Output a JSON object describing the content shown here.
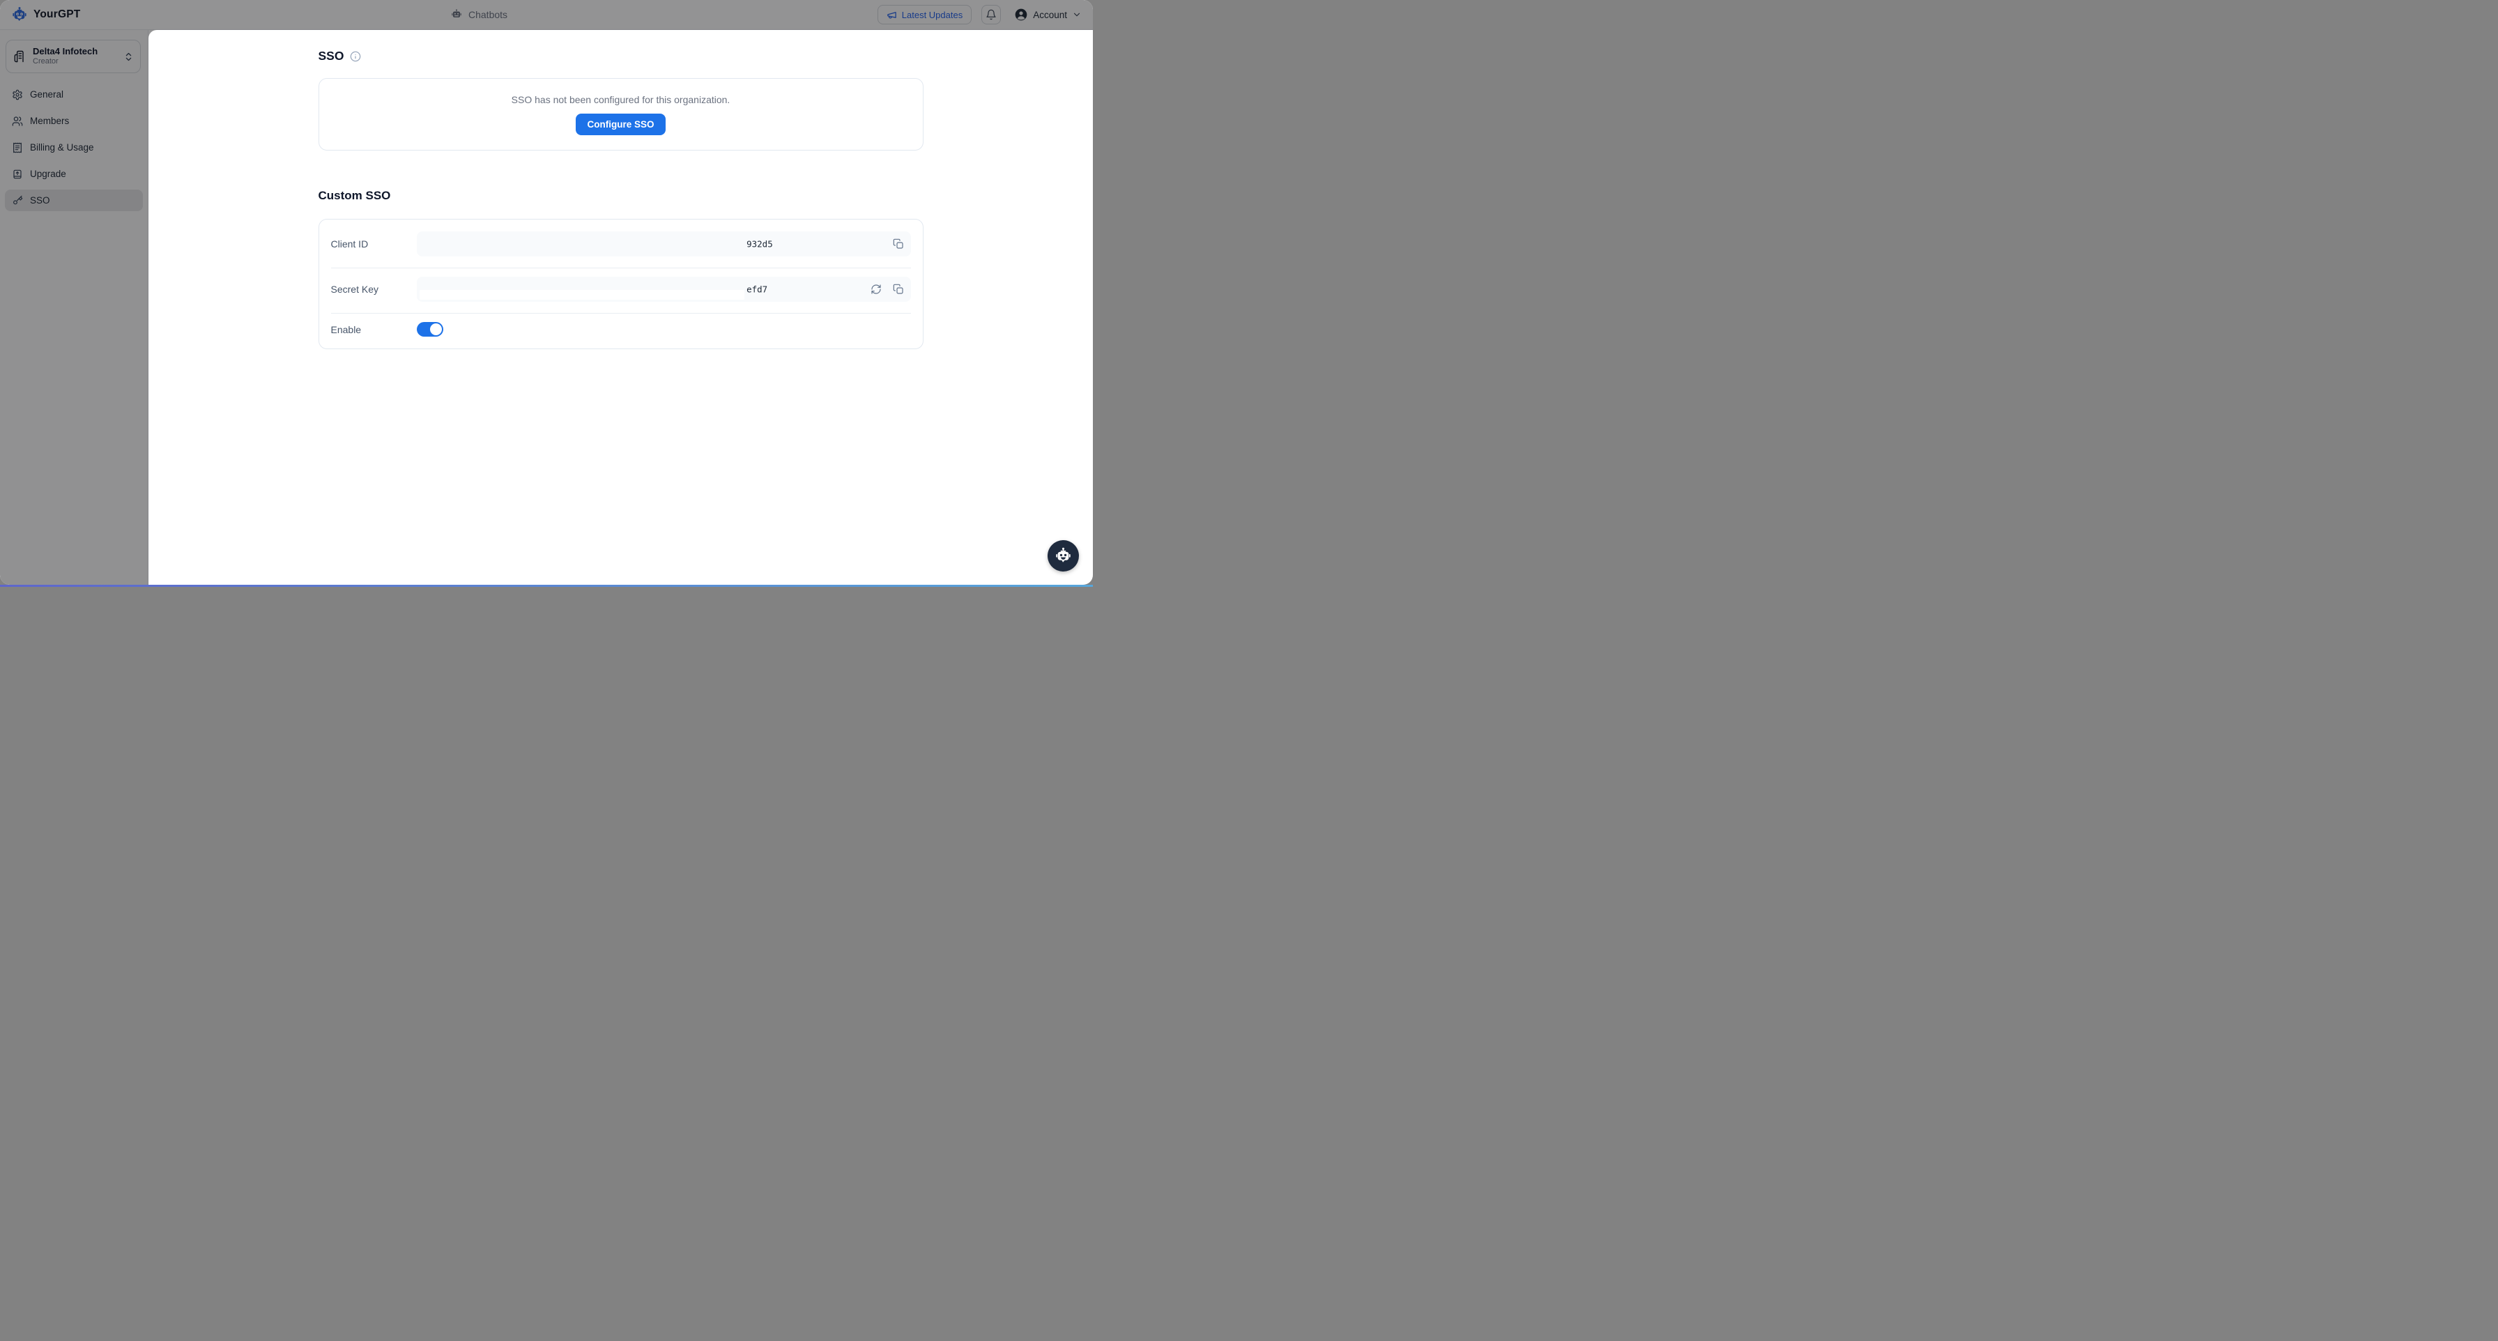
{
  "topbar": {
    "brand": "YourGPT",
    "nav_chatbots": "Chatbots",
    "latest_updates_label": "Latest Updates",
    "account_label": "Account"
  },
  "sidebar": {
    "org": {
      "name": "Delta4 Infotech",
      "role": "Creator"
    },
    "items": [
      {
        "label": "General",
        "icon": "gear-icon",
        "active": false
      },
      {
        "label": "Members",
        "icon": "users-icon",
        "active": false
      },
      {
        "label": "Billing & Usage",
        "icon": "receipt-icon",
        "active": false
      },
      {
        "label": "Upgrade",
        "icon": "upgrade-icon",
        "active": false
      },
      {
        "label": "SSO",
        "icon": "key-icon",
        "active": true
      }
    ]
  },
  "main": {
    "sso": {
      "title": "SSO",
      "empty_message": "SSO has not been configured for this organization.",
      "configure_button_label": "Configure SSO"
    },
    "custom_sso": {
      "title": "Custom SSO",
      "client_id": {
        "label": "Client ID",
        "visible_value": "932d5"
      },
      "secret_key": {
        "label": "Secret Key",
        "visible_value": "efd7"
      },
      "enable": {
        "label": "Enable",
        "enabled": true
      }
    }
  },
  "icons": {
    "brand": "robot-icon",
    "nav": "robot-icon",
    "updates": "megaphone-icon",
    "notifications": "bell-icon",
    "account": "user-circle-icon",
    "info": "info-circle-icon",
    "copy": "copy-icon",
    "regenerate": "refresh-icon",
    "chat_launcher": "robot-icon"
  },
  "colors": {
    "accent_blue": "#1d72e8",
    "brand_blue": "#2563eb",
    "dim_overlay": "rgba(10,10,12,0.44)",
    "panel_bg": "#ffffff",
    "field_bg": "#f8fafc",
    "border": "#e2e8f0",
    "active_item_bg": "#e4e4e7",
    "widget_bg": "#1f2b3e"
  },
  "state": {
    "dimmed_background": true,
    "active_sidebar_item": "SSO"
  }
}
